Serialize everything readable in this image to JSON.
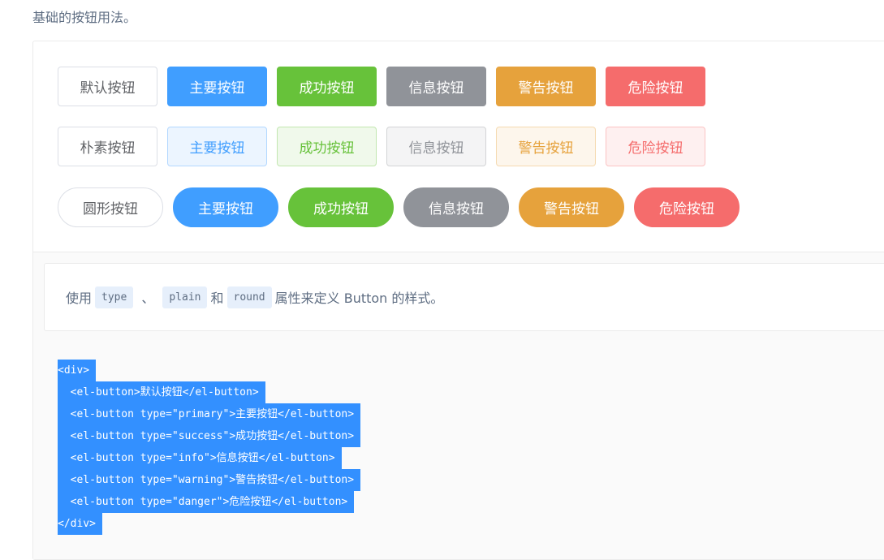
{
  "intro_text": "基础的按钮用法。",
  "rows": {
    "default": {
      "default": "默认按钮",
      "primary": "主要按钮",
      "success": "成功按钮",
      "info": "信息按钮",
      "warning": "警告按钮",
      "danger": "危险按钮"
    },
    "plain": {
      "default": "朴素按钮",
      "primary": "主要按钮",
      "success": "成功按钮",
      "info": "信息按钮",
      "warning": "警告按钮",
      "danger": "危险按钮"
    },
    "round": {
      "default": "圆形按钮",
      "primary": "主要按钮",
      "success": "成功按钮",
      "info": "信息按钮",
      "warning": "警告按钮",
      "danger": "危险按钮"
    }
  },
  "description": {
    "prefix": "使用",
    "code1": "type",
    "sep": "、",
    "code2": "plain",
    "and": "和",
    "code3": "round",
    "suffix": "属性来定义 Button 的样式。"
  },
  "code_lines": [
    "<div>",
    "  <el-button>默认按钮</el-button>",
    "  <el-button type=\"primary\">主要按钮</el-button>",
    "  <el-button type=\"success\">成功按钮</el-button>",
    "  <el-button type=\"info\">信息按钮</el-button>",
    "  <el-button type=\"warning\">警告按钮</el-button>",
    "  <el-button type=\"danger\">危险按钮</el-button>",
    "</div>"
  ],
  "colors": {
    "primary": "#409eff",
    "success": "#67c23a",
    "info": "#909399",
    "warning": "#e6a23c",
    "danger": "#f56c6c",
    "selection": "#3390ff"
  }
}
